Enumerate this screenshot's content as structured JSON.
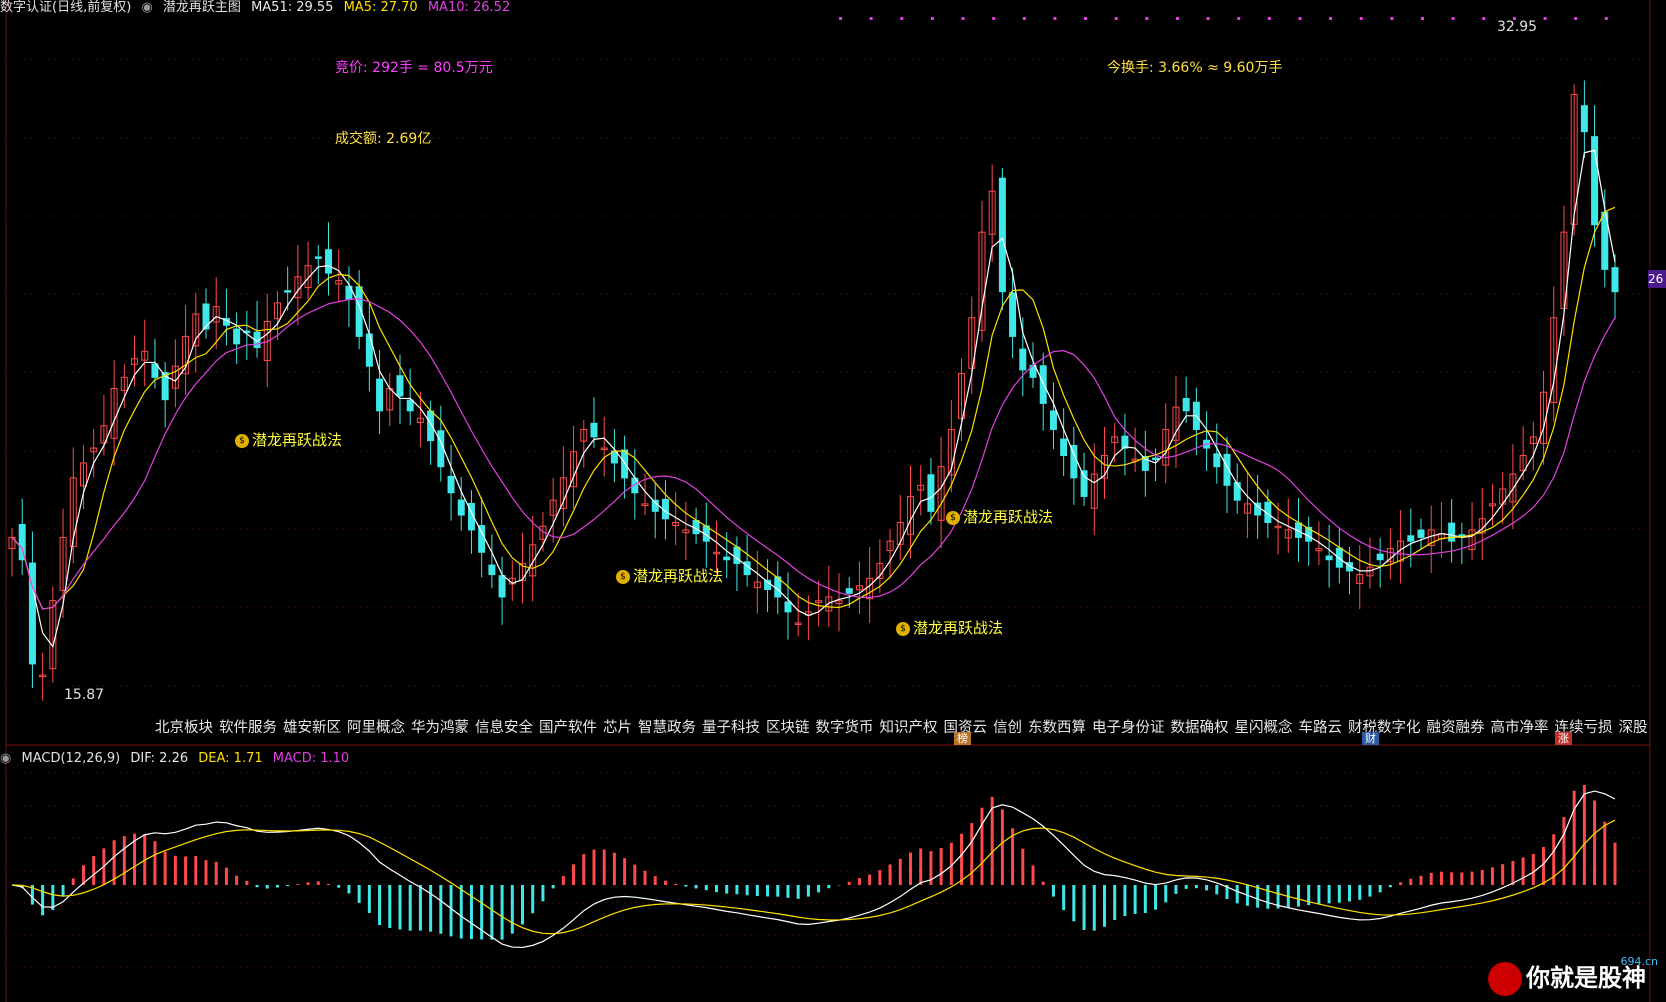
{
  "header": {
    "title": "数字认证(日线,前复权)",
    "indicator": "潜龙再跃主图",
    "ma51": "MA51: 29.55",
    "ma5": "MA5: 27.70",
    "ma10": "MA10: 26.52"
  },
  "info": {
    "auction": "竞价: 292手 = 80.5万元",
    "turnover": "今换手: 3.66% ≈ 9.60万手",
    "amount": "成交额: 2.69亿"
  },
  "price_labels": {
    "high": "32.95",
    "low": "15.87",
    "right_tag": "26"
  },
  "signals": [
    {
      "label": "潜龙再跃战法"
    },
    {
      "label": "潜龙再跃战法"
    },
    {
      "label": "潜龙再跃战法"
    },
    {
      "label": "潜龙再跃战法"
    }
  ],
  "concept_tags": [
    "北京板块",
    "软件服务",
    "雄安新区",
    "阿里概念",
    "华为鸿蒙",
    "信息安全",
    "国产软件",
    "芯片",
    "智慧政务",
    "量子科技",
    "区块链",
    "数字货币",
    "知识产权",
    "国资云",
    "信创",
    "东数西算",
    "电子身份证",
    "数据确权",
    "星闪概念",
    "车路云",
    "财税数字化",
    "融资融券",
    "高市净率",
    "连续亏损",
    "深股"
  ],
  "badges": [
    {
      "text": "榜",
      "color": "#b8742a"
    },
    {
      "text": "财",
      "color": "#2d5aa0"
    },
    {
      "text": "涨",
      "color": "#c0302a"
    }
  ],
  "macd_header": {
    "name": "MACD(12,26,9)",
    "dif": "DIF: 2.26",
    "dea": "DEA: 1.71",
    "macd": "MACD: 1.10"
  },
  "watermark": {
    "text": "你就是股神",
    "sub": "694.cn"
  },
  "colors": {
    "up": "#ff4a4a",
    "down": "#3ee8e8",
    "ma5": "#ffffff",
    "ma10": "#ffe000",
    "ma51": "#e040e0",
    "bg": "#000000"
  },
  "chart_data": {
    "type": "candlestick",
    "closes": [
      19.6,
      19.0,
      16.2,
      15.9,
      17.9,
      19.6,
      21.2,
      21.6,
      22.0,
      22.6,
      23.6,
      23.9,
      24.4,
      24.6,
      23.9,
      23.3,
      24.2,
      25.0,
      25.6,
      25.2,
      25.8,
      25.3,
      24.8,
      25.1,
      24.7,
      25.4,
      25.9,
      26.2,
      26.6,
      26.9,
      27.1,
      26.7,
      26.5,
      26.0,
      25.0,
      24.2,
      23.0,
      23.6,
      23.4,
      23.0,
      22.8,
      22.2,
      21.5,
      20.8,
      20.2,
      19.8,
      19.2,
      18.6,
      18.0,
      18.5,
      18.9,
      19.4,
      19.9,
      20.6,
      21.2,
      21.9,
      22.5,
      22.3,
      22.0,
      21.6,
      21.2,
      20.8,
      20.5,
      20.3,
      20.1,
      20.0,
      19.8,
      19.7,
      19.5,
      19.2,
      19.0,
      18.9,
      18.6,
      18.4,
      18.2,
      18.0,
      17.6,
      17.3,
      17.6,
      17.9,
      18.0,
      17.9,
      18.1,
      18.3,
      18.5,
      18.9,
      19.5,
      20.0,
      20.7,
      21.0,
      20.3,
      21.5,
      22.5,
      24.0,
      25.5,
      27.8,
      28.9,
      26.2,
      25.0,
      24.1,
      23.9,
      23.2,
      22.5,
      21.8,
      21.2,
      20.7,
      21.3,
      21.8,
      22.3,
      22.0,
      21.7,
      21.4,
      21.7,
      22.5,
      23.1,
      23.0,
      22.5,
      22.0,
      21.5,
      21.0,
      20.6,
      20.5,
      20.2,
      20.0,
      19.9,
      19.8,
      19.6,
      19.5,
      19.3,
      19.0,
      18.8,
      18.7,
      18.6,
      18.8,
      19.0,
      19.3,
      19.5,
      19.5,
      19.6,
      19.8,
      19.7,
      19.5,
      19.6,
      19.8,
      20.1,
      20.5,
      20.9,
      21.3,
      21.8,
      22.3,
      23.5,
      25.5,
      27.8,
      31.5,
      30.5,
      28.0,
      26.8,
      26.2
    ],
    "ma51_end": 29.55,
    "ma5_end": 27.7,
    "ma10_end": 26.52,
    "high": 32.95,
    "low": 15.87,
    "macd": {
      "dif": 2.26,
      "dea": 1.71,
      "hist": 1.1
    }
  }
}
